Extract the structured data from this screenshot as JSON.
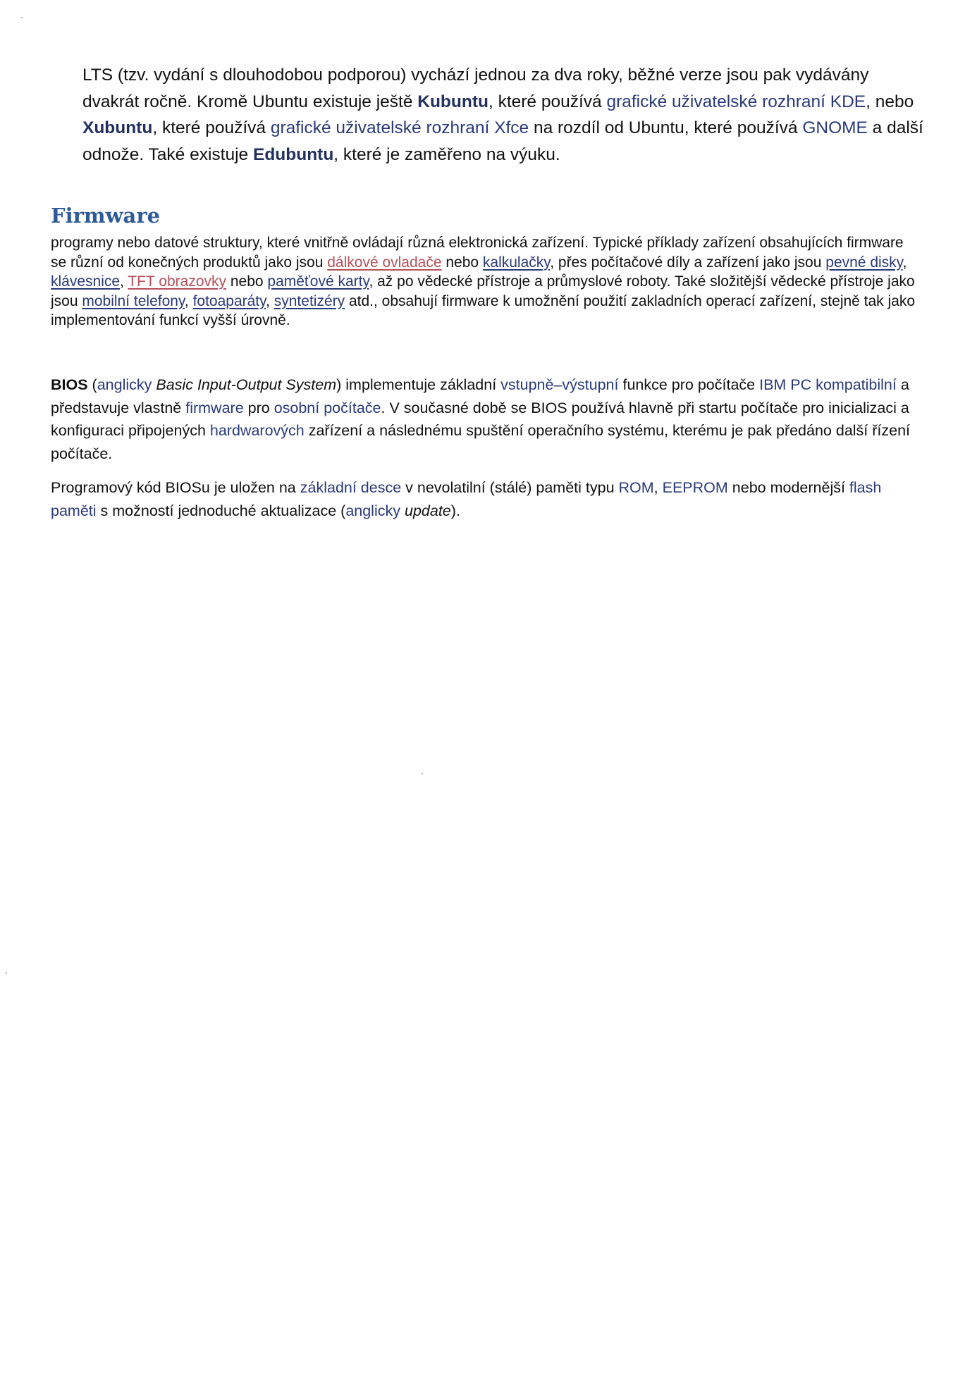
{
  "section1": {
    "t1": "LTS (tzv. vydání s dlouhodobou podporou) vychází jednou za dva roky, běžné verze jsou pak vydávány dvakrát ročně. Kromě Ubuntu existuje ještě ",
    "kubuntu": "Kubuntu",
    "t2": ", které používá ",
    "link_gui_kde": "grafické uživatelské rozhraní KDE",
    "t3": ", nebo ",
    "xubuntu": "Xubuntu",
    "t4": ", které používá ",
    "link_gui_xfce": "grafické uživatelské rozhraní Xfce",
    "t5": " na rozdíl od Ubuntu, které používá ",
    "link_gnome": "GNOME",
    "t6": " a další odnože. Také existuje ",
    "edubuntu": "Edubuntu",
    "t7": ", které je zaměřeno na výuku."
  },
  "firmware": {
    "heading": "Firmware",
    "t1": "programy nebo datové struktury, které vnitřně ovládají různá elektronická zařízení. Typické příklady zařízení obsahujících firmware se různí od konečných produktů jako jsou ",
    "link_dalkove": "dálkové ovladače",
    "t2": " nebo ",
    "link_kalkulacky": "kalkulačky",
    "t3": ", přes počítačové díly a zařízení jako jsou ",
    "link_pevne_disky": "pevné disky",
    "t4": ", ",
    "link_klavesnice": "klávesnice",
    "t5": ", ",
    "link_tft": "TFT obrazovky",
    "t6": " nebo ",
    "link_pametove": "paměťové karty",
    "t7": ", až po vědecké přístroje a průmyslové roboty. Také složitější vědecké přístroje jako jsou ",
    "link_mobilni": "mobilní telefony",
    "t8": ", ",
    "link_fotoaparaty": "fotoaparáty",
    "t9": ", ",
    "link_syntetizery": "syntetizéry",
    "t10": " atd., obsahují firmware k umožnění použití zakladních operací zařízení, stejně tak jako implementování funkcí vyšší úrovně."
  },
  "bios": {
    "bios_bold": "BIOS",
    "t1": " (",
    "link_anglicky1": "anglicky",
    "t2": " ",
    "basic_ios": "Basic Input-Output System",
    "t3": ") implementuje základní ",
    "link_vstupne": "vstupně–výstupní",
    "t4": " funkce pro počítače ",
    "link_ibm": "IBM PC kompatibilní",
    "t5": " a představuje vlastně ",
    "link_firmware": "firmware",
    "t6": " pro ",
    "link_osobni": "osobní počítače",
    "t7": ". V současné době se BIOS používá hlavně při startu počítače pro inicializaci a konfiguraci připojených ",
    "link_hardwarovych": "hardwarových",
    "t8": " zařízení a následnému spuštění operačního systému, kterému je pak předáno další řízení počítače."
  },
  "bios2": {
    "t1": "Programový kód BIOSu je uložen na ",
    "link_zakladni_desce": "základní desce",
    "t2": " v nevolatilní (stálé) paměti typu ",
    "link_rom": "ROM",
    "t3": ", ",
    "link_eeprom": "EEPROM",
    "t4": " nebo modernější ",
    "link_flash": "flash paměti",
    "t5": " s možností jednoduché aktualizace (",
    "link_anglicky2": "anglicky",
    "t6": " ",
    "update": "update",
    "t7": ")."
  }
}
